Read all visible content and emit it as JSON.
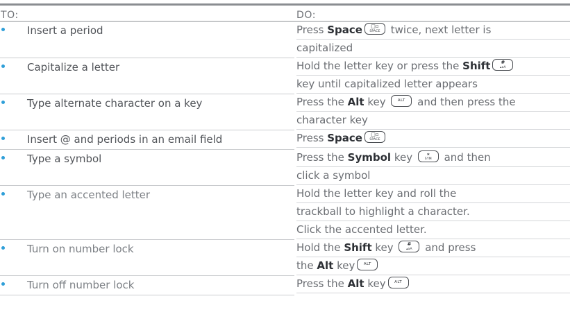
{
  "table": {
    "header_to": "TO:",
    "header_do": "DO:",
    "bullet_color": "#2f9fd8"
  },
  "keys": {
    "space": {
      "top": "□▫",
      "bottom": "SPACE"
    },
    "shift": {
      "top": "#",
      "bottom": "▴aA"
    },
    "alt": {
      "label": "ALT"
    },
    "sym": {
      "top": "⁎",
      "bottom": "SYM"
    }
  },
  "rows": [
    {
      "to": "Insert a period",
      "do": [
        "Press ",
        "Space",
        " twice, next letter is",
        "capitalized"
      ]
    },
    {
      "to": "Capitalize a letter",
      "do": [
        "Hold the letter key or press the ",
        "Shift",
        "key until capitalized letter appears"
      ]
    },
    {
      "to": "Type alternate character on a key",
      "do": [
        "Press the ",
        "Alt",
        " key ",
        " and then press the",
        "character key"
      ]
    },
    {
      "to": "Insert @ and periods in an email field",
      "do": [
        "Press ",
        "Space"
      ]
    },
    {
      "to": "Type a symbol",
      "do": [
        "Press the ",
        "Symbol",
        " key ",
        " and then",
        "click a symbol"
      ]
    },
    {
      "to": "Type an accented letter",
      "do": [
        "Hold the letter key and roll the",
        "trackball to highlight a character.",
        "Click the accented letter."
      ]
    },
    {
      "to": "Turn on number lock",
      "do": [
        "Hold the ",
        "Shift",
        " key ",
        " and press",
        "the ",
        "Alt",
        " key"
      ]
    },
    {
      "to": "Turn off number lock",
      "do": [
        "Press the ",
        "Alt",
        " key"
      ]
    }
  ]
}
